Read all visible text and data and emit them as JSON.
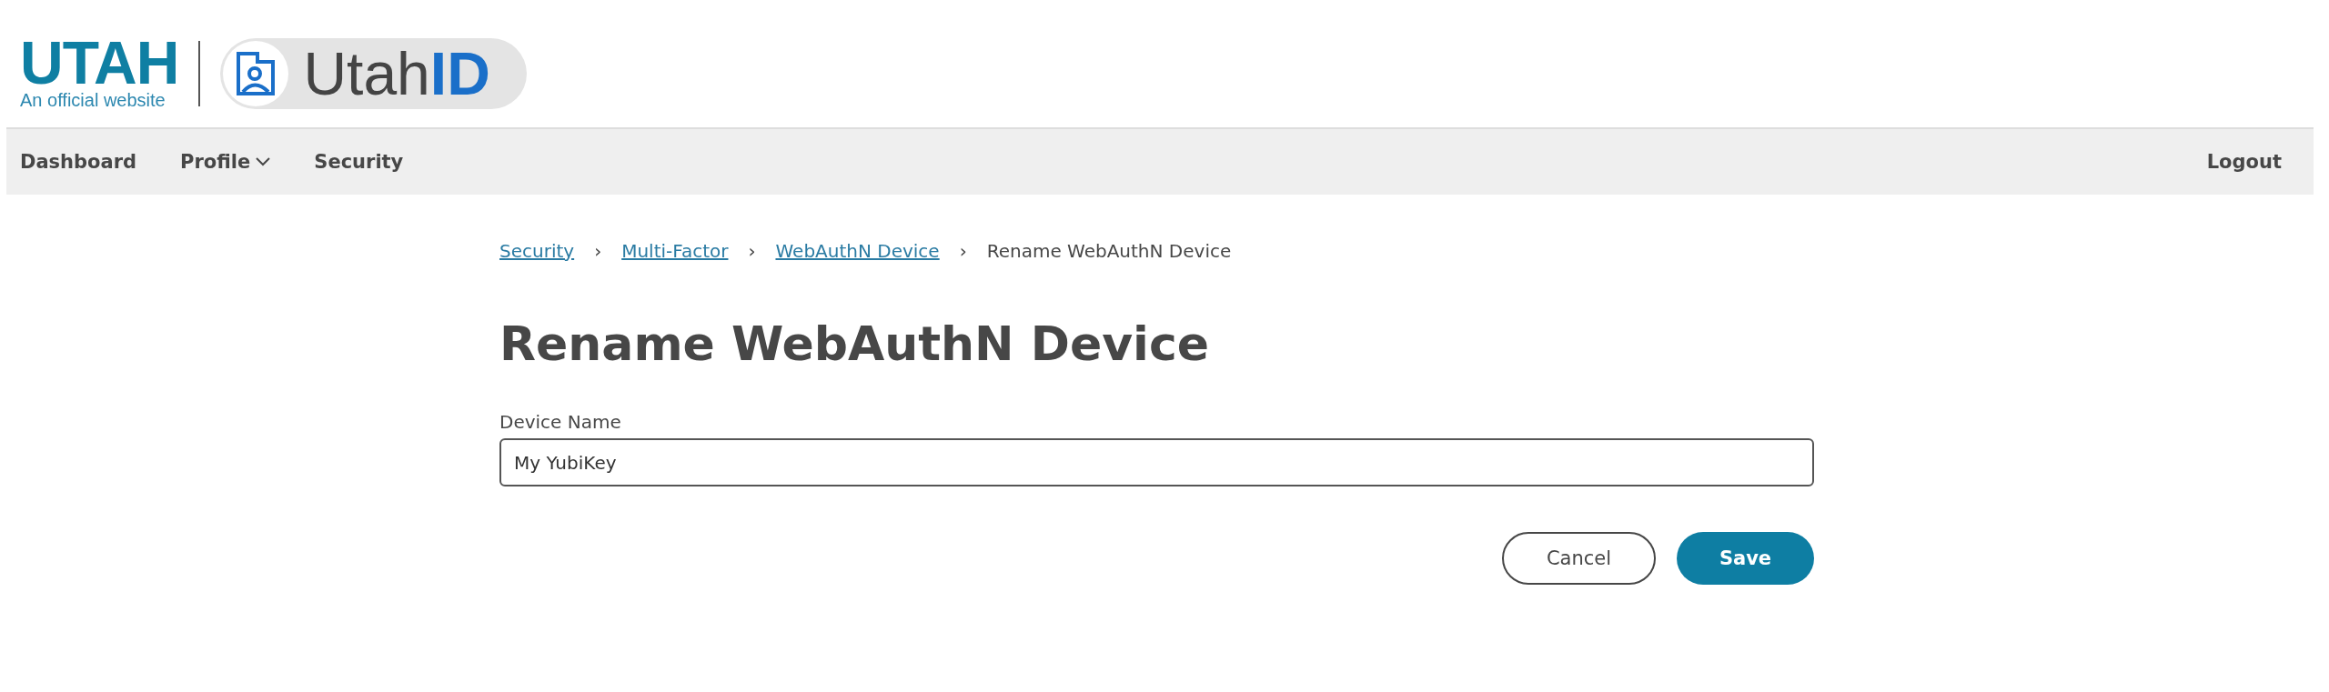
{
  "header": {
    "state_logo": "UTAH",
    "state_tagline": "An official website",
    "app_name_prefix": "Utah",
    "app_name_suffix": "ID"
  },
  "nav": {
    "items": [
      {
        "label": "Dashboard",
        "has_menu": false
      },
      {
        "label": "Profile",
        "has_menu": true
      },
      {
        "label": "Security",
        "has_menu": false
      }
    ],
    "logout": "Logout"
  },
  "breadcrumb": [
    {
      "label": "Security",
      "kind": "link"
    },
    {
      "label": "Multi-Factor",
      "kind": "link"
    },
    {
      "label": "WebAuthN Device",
      "kind": "link"
    },
    {
      "label": "Rename WebAuthN Device",
      "kind": "current"
    }
  ],
  "breadcrumb_separator": "›",
  "title": "Rename WebAuthN Device",
  "field": {
    "label": "Device Name",
    "value": "My YubiKey"
  },
  "buttons": [
    {
      "label": "Cancel",
      "kind": "secondary"
    },
    {
      "label": "Save",
      "kind": "primary"
    }
  ]
}
